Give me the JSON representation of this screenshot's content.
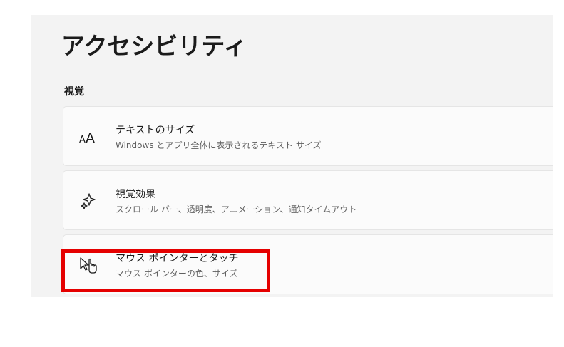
{
  "page": {
    "title": "アクセシビリティ"
  },
  "section": {
    "heading": "視覚"
  },
  "cards": [
    {
      "icon": "text-size-icon",
      "title": "テキストのサイズ",
      "description": "Windows とアプリ全体に表示されるテキスト サイズ"
    },
    {
      "icon": "sparkle-icon",
      "title": "視覚効果",
      "description": "スクロール バー、透明度、アニメーション、通知タイムアウト"
    },
    {
      "icon": "mouse-pointer-touch-icon",
      "title": "マウス ポインターとタッチ",
      "description": "マウス ポインターの色、サイズ"
    }
  ],
  "colors": {
    "background": "#f3f3f3",
    "card": "#fbfbfb",
    "highlight": "#e50000"
  }
}
